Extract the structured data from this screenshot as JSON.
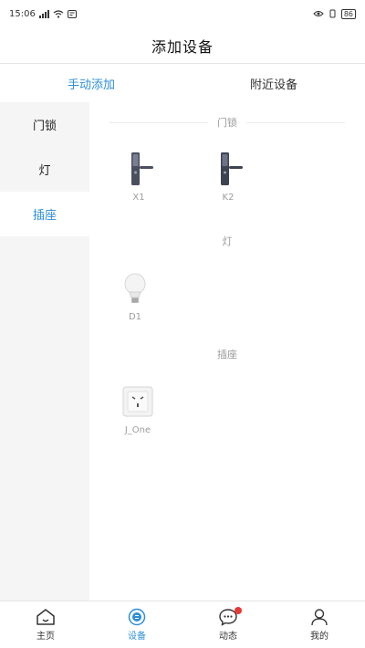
{
  "status_bar": {
    "time": "15:06",
    "battery": "86"
  },
  "header": {
    "title": "添加设备"
  },
  "tabs": [
    {
      "label": "手动添加",
      "active": true
    },
    {
      "label": "附近设备",
      "active": false
    }
  ],
  "sidebar": {
    "items": [
      {
        "label": "门锁",
        "active": false
      },
      {
        "label": "灯",
        "active": false
      },
      {
        "label": "插座",
        "active": true
      }
    ]
  },
  "sections": [
    {
      "title": "门锁",
      "devices": [
        {
          "name": "X1",
          "icon": "door-lock-icon"
        },
        {
          "name": "K2",
          "icon": "door-lock-icon"
        }
      ]
    },
    {
      "title": "灯",
      "devices": [
        {
          "name": "D1",
          "icon": "light-bulb-icon"
        }
      ]
    },
    {
      "title": "插座",
      "devices": [
        {
          "name": "J_One",
          "icon": "socket-icon"
        }
      ]
    }
  ],
  "bottom_nav": {
    "items": [
      {
        "label": "主页",
        "icon": "home-icon",
        "active": false
      },
      {
        "label": "设备",
        "icon": "device-icon",
        "active": true
      },
      {
        "label": "动态",
        "icon": "message-icon",
        "active": false,
        "badge": true
      },
      {
        "label": "我的",
        "icon": "user-icon",
        "active": false
      }
    ]
  },
  "colors": {
    "accent": "#2e8fd6",
    "badge": "#e53935",
    "sidebar_bg": "#f5f5f5"
  }
}
